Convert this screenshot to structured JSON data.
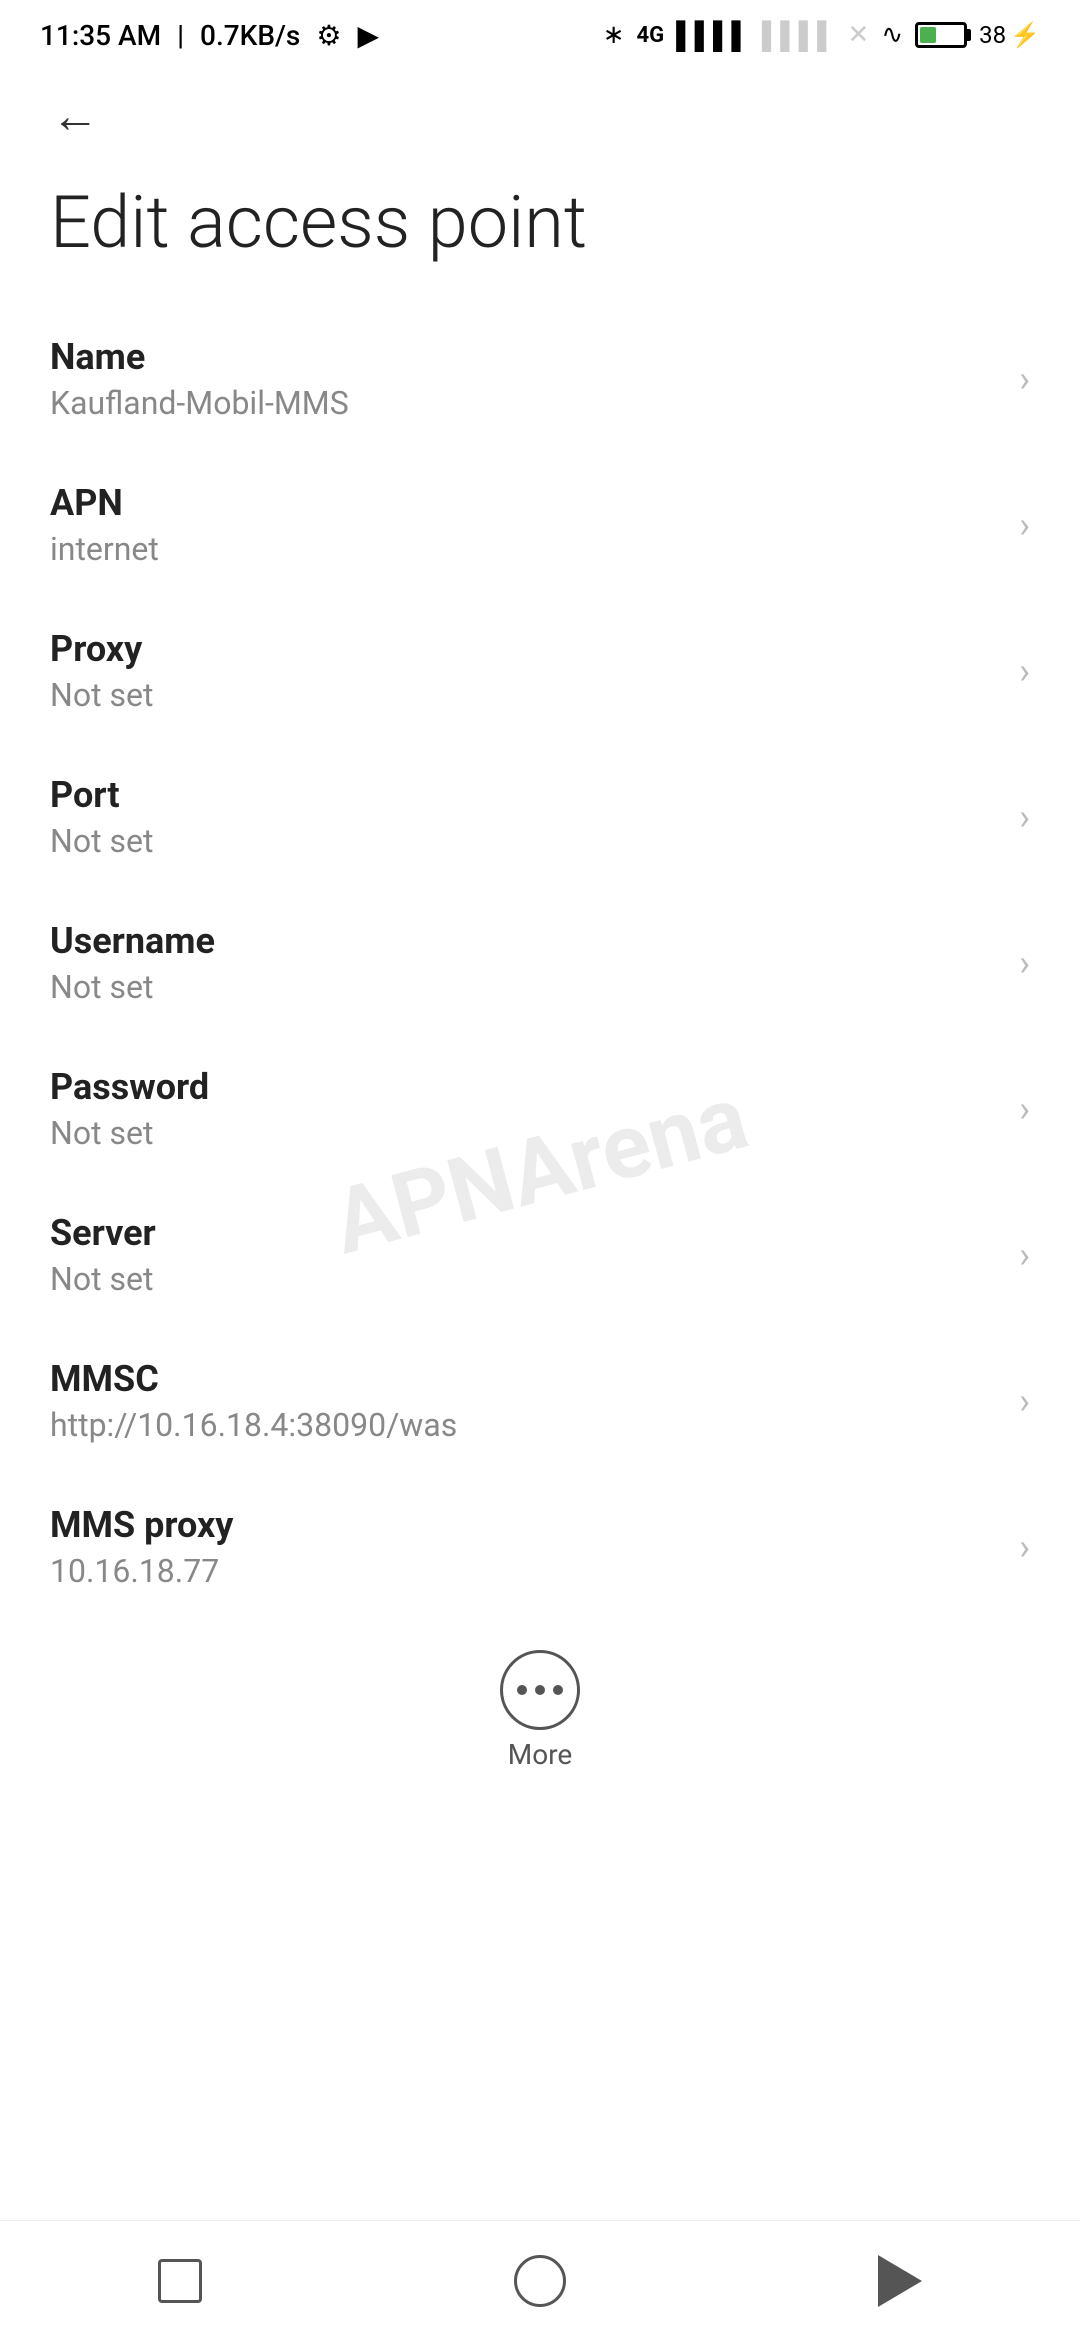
{
  "statusBar": {
    "time": "11:35 AM",
    "speed": "0.7KB/s",
    "battery": "38"
  },
  "toolbar": {
    "backLabel": "←"
  },
  "page": {
    "title": "Edit access point"
  },
  "settings": [
    {
      "label": "Name",
      "value": "Kaufland-Mobil-MMS"
    },
    {
      "label": "APN",
      "value": "internet"
    },
    {
      "label": "Proxy",
      "value": "Not set"
    },
    {
      "label": "Port",
      "value": "Not set"
    },
    {
      "label": "Username",
      "value": "Not set"
    },
    {
      "label": "Password",
      "value": "Not set"
    },
    {
      "label": "Server",
      "value": "Not set"
    },
    {
      "label": "MMSC",
      "value": "http://10.16.18.4:38090/was"
    },
    {
      "label": "MMS proxy",
      "value": "10.16.18.77"
    }
  ],
  "more": {
    "label": "More"
  },
  "watermark": "APNArena",
  "navBar": {
    "squareBtn": "square",
    "circleBtn": "circle",
    "triangleBtn": "triangle"
  }
}
